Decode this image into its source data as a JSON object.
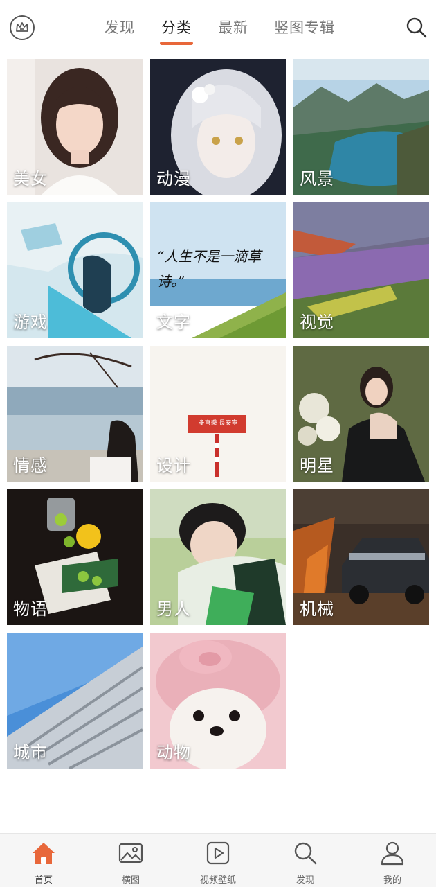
{
  "header": {
    "tabs": [
      {
        "label": "发现",
        "active": false
      },
      {
        "label": "分类",
        "active": true
      },
      {
        "label": "最新",
        "active": false
      },
      {
        "label": "竖图专辑",
        "active": false
      }
    ],
    "crown_icon": "crown-icon",
    "search_icon": "search-icon",
    "accent_color": "#e8673a"
  },
  "categories": [
    {
      "label": "美女"
    },
    {
      "label": "动漫"
    },
    {
      "label": "风景"
    },
    {
      "label": "游戏"
    },
    {
      "label": "文字",
      "image_text": "“人生不是一滴草诗。”"
    },
    {
      "label": "视觉"
    },
    {
      "label": "情感"
    },
    {
      "label": "设计",
      "sign_text": "多喜樂 長安寧"
    },
    {
      "label": "明星"
    },
    {
      "label": "物语"
    },
    {
      "label": "男人"
    },
    {
      "label": "机械"
    },
    {
      "label": "城市"
    },
    {
      "label": "动物"
    }
  ],
  "bottom_nav": [
    {
      "label": "首页",
      "icon": "home-icon",
      "active": true
    },
    {
      "label": "横图",
      "icon": "image-icon",
      "active": false
    },
    {
      "label": "视频壁纸",
      "icon": "video-icon",
      "active": false
    },
    {
      "label": "发现",
      "icon": "search-icon",
      "active": false
    },
    {
      "label": "我的",
      "icon": "user-icon",
      "active": false
    }
  ]
}
